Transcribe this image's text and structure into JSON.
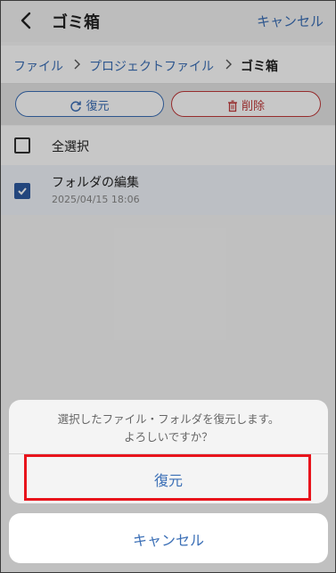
{
  "header": {
    "title": "ゴミ箱",
    "cancel_label": "キャンセル"
  },
  "breadcrumb": {
    "items": [
      "ファイル",
      "プロジェクトファイル",
      "ゴミ箱"
    ]
  },
  "actions": {
    "restore_label": "復元",
    "delete_label": "削除"
  },
  "list": {
    "select_all_label": "全選択",
    "items": [
      {
        "name": "フォルダの編集",
        "date": "2025/04/15 18:06",
        "checked": true
      }
    ]
  },
  "dialog": {
    "message_line1": "選択したファイル・フォルダを復元します。",
    "message_line2": "よろしいですか？",
    "confirm_label": "復元",
    "cancel_label": "キャンセル"
  },
  "colors": {
    "accent": "#3b6fb6",
    "danger": "#c0393a",
    "highlight": "#e8141c"
  }
}
